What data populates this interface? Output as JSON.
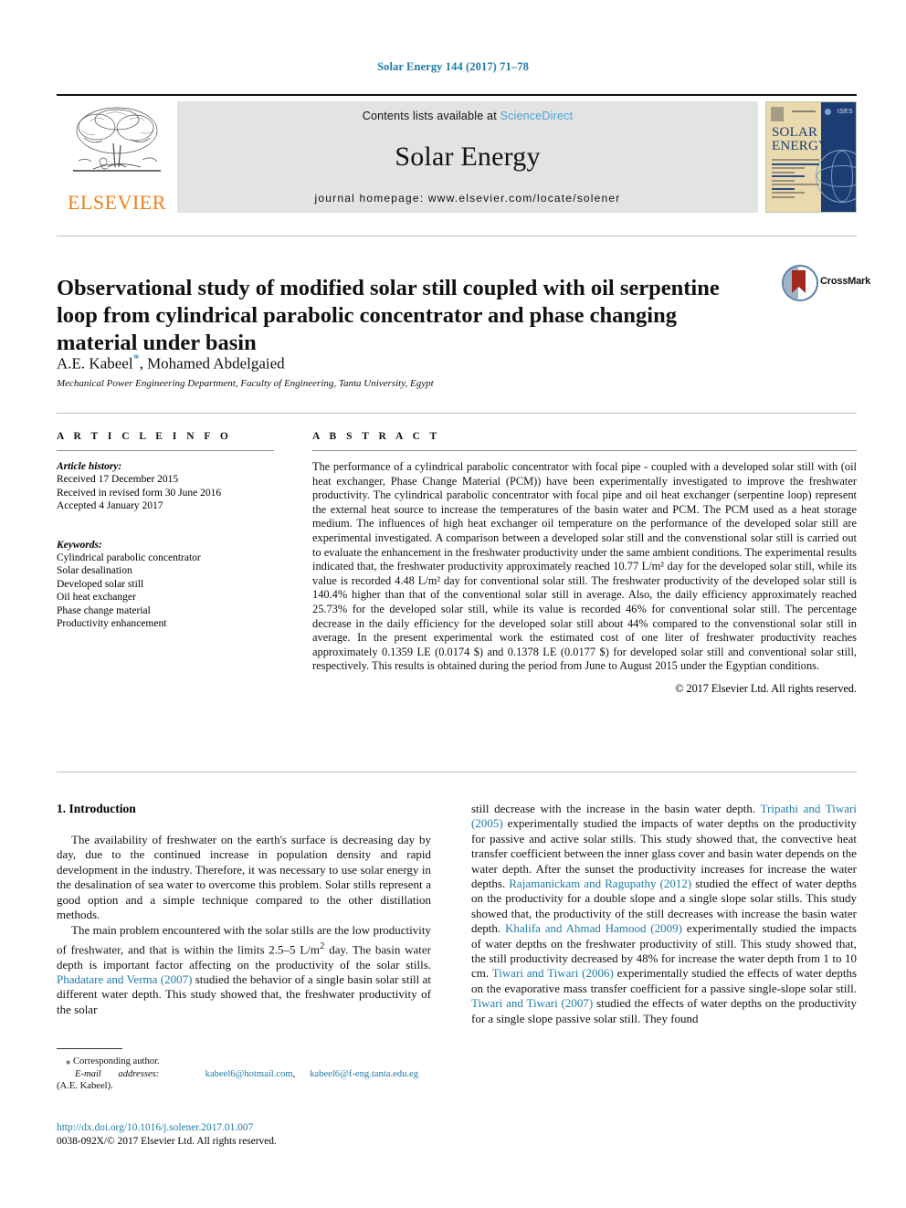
{
  "running_head": "Solar Energy 144 (2017) 71–78",
  "masthead": {
    "publisher_name": "ELSEVIER",
    "contents_prefix": "Contents lists available at",
    "contents_link": "ScienceDirect",
    "journal_title": "Solar Energy",
    "homepage": "journal homepage: www.elsevier.com/locate/solener",
    "cover": {
      "title_line1": "SOLAR",
      "title_line2": "ENERGY",
      "society": "ISES"
    }
  },
  "article": {
    "title": "Observational study of modified solar still coupled with oil serpentine loop from cylindrical parabolic concentrator and phase changing material under basin",
    "crossmark_label": "CrossMark",
    "authors": "A.E. Kabeel",
    "authors_rest": ", Mohamed Abdelgaied",
    "corresponding_marker": "*",
    "affiliation": "Mechanical Power Engineering Department, Faculty of Engineering, Tanta University, Egypt"
  },
  "article_info": {
    "label": "A R T I C L E   I N F O",
    "history_head": "Article history:",
    "history": [
      "Received 17 December 2015",
      "Received in revised form 30 June 2016",
      "Accepted 4 January 2017"
    ],
    "keywords_head": "Keywords:",
    "keywords": [
      "Cylindrical parabolic concentrator",
      "Solar desalination",
      "Developed solar still",
      "Oil heat exchanger",
      "Phase change material",
      "Productivity enhancement"
    ]
  },
  "abstract": {
    "label": "A B S T R A C T",
    "text": "The performance of a cylindrical parabolic concentrator with focal pipe - coupled with a developed solar still with (oil heat exchanger, Phase Change Material (PCM)) have been experimentally investigated to improve the freshwater productivity. The cylindrical parabolic concentrator with focal pipe and oil heat exchanger (serpentine loop) represent the external heat source to increase the temperatures of the basin water and PCM. The PCM used as a heat storage medium. The influences of high heat exchanger oil temperature on the performance of the developed solar still are experimental investigated. A comparison between a developed solar still and the convenstional solar still is carried out to evaluate the enhancement in the freshwater productivity under the same ambient conditions. The experimental results indicated that, the freshwater productivity approximately reached 10.77 L/m² day for the developed solar still, while its value is recorded 4.48 L/m² day for conventional solar still. The freshwater productivity of the developed solar still is 140.4% higher than that of the conventional solar still in average. Also, the daily efficiency approximately reached 25.73% for the developed solar still, while its value is recorded 46% for conventional solar still. The percentage decrease in the daily efficiency for the developed solar still about 44% compared to the convenstional solar still in average. In the present experimental work the estimated cost of one liter of freshwater productivity reaches approximately 0.1359 LE (0.0174 $) and 0.1378 LE (0.0177 $) for developed solar still and conventional solar still, respectively. This results is obtained during the period from June to August 2015 under the Egyptian conditions.",
    "copyright": "© 2017 Elsevier Ltd. All rights reserved."
  },
  "introduction": {
    "heading": "1. Introduction",
    "left_paragraphs": [
      "The availability of freshwater on the earth's surface is decreasing day by day, due to the continued increase in population density and rapid development in the industry. Therefore, it was necessary to use solar energy in the desalination of sea water to overcome this problem. Solar stills represent a good option and a simple technique compared to the other distillation methods."
    ],
    "left_p2_a": "The main problem encountered with the solar stills are the low productivity of freshwater, and that is within the limits 2.5–5 L/m",
    "left_p2_sup": "2",
    "left_p2_b": " day. The basin water depth is important factor affecting on the productivity of the solar stills. ",
    "left_cite1": "Phadatare and Verma (2007)",
    "left_p2_c": " studied the behavior of a single basin solar still at different water depth. This study showed that, the freshwater productivity of the solar",
    "right_p_a": "still decrease with the increase in the basin water depth. ",
    "right_cite1": "Tripathi and Tiwari (2005)",
    "right_p_b": " experimentally studied the impacts of water depths on the productivity for passive and active solar stills. This study showed that, the convective heat transfer coefficient between the inner glass cover and basin water depends on the water depth. After the sunset the productivity increases for increase the water depths. ",
    "right_cite2": "Rajamanickam and Ragupathy (2012)",
    "right_p_c": " studied the effect of water depths on the productivity for a double slope and a single slope solar stills. This study showed that, the productivity of the still decreases with increase the basin water depth. ",
    "right_cite3": "Khalifa and Ahmad Hamood (2009)",
    "right_p_d": " experimentally studied the impacts of water depths on the freshwater productivity of still. This study showed that, the still productivity decreased by 48% for increase the water depth from 1 to 10 cm. ",
    "right_cite4": "Tiwari and Tiwari (2006)",
    "right_p_e": " experimentally studied the effects of water depths on the evaporative mass transfer coefficient for a passive single-slope solar still. ",
    "right_cite5": "Tiwari and Tiwari (2007)",
    "right_p_f": " studied the effects of water depths on the productivity for a single slope passive solar still. They found"
  },
  "footnotes": {
    "corresponding": "⁎ Corresponding author.",
    "email_label": "E-mail",
    "email_label2": "addresses:",
    "email1": "kabeel6@hotmail.com",
    "email_sep": ",",
    "email2": "kabeel6@f-eng.tanta.edu.eg",
    "email_owner": "(A.E. Kabeel)."
  },
  "footer": {
    "doi": "http://dx.doi.org/10.1016/j.solener.2017.01.007",
    "issn_line": "0038-092X/© 2017 Elsevier Ltd. All rights reserved."
  },
  "colors": {
    "link": "#1f7ba8",
    "sciencedirect": "#4aa3d6",
    "elsevier_orange": "#ef7d1a",
    "cover_navy": "#1b3d74",
    "crossmark_red": "#a32820"
  }
}
